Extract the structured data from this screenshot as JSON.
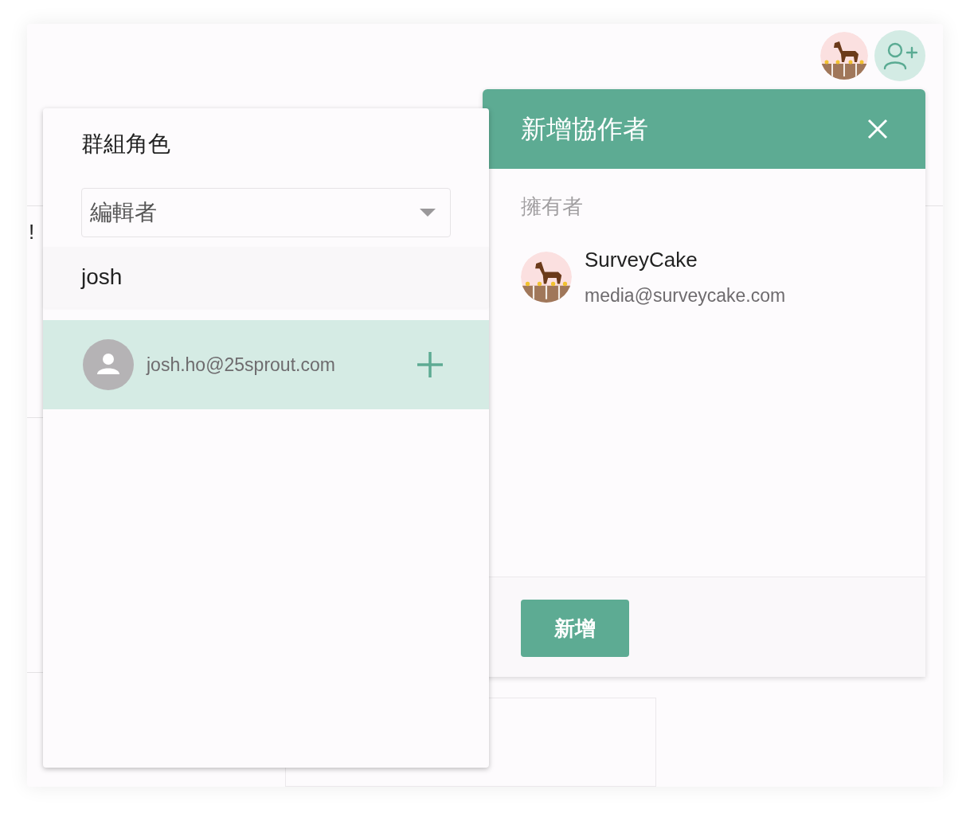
{
  "background_fragments": [
    "!"
  ],
  "role_popover": {
    "label": "群組角色",
    "role_select": {
      "value": "編輯者"
    },
    "search": {
      "value": "josh"
    },
    "results": [
      {
        "email": "josh.ho@25sprout.com",
        "selected": true
      }
    ]
  },
  "dialog": {
    "title": "新增協作者",
    "section_label": "擁有者",
    "owners": [
      {
        "name": "SurveyCake",
        "email": "media@surveycake.com"
      }
    ],
    "submit": "新增"
  }
}
